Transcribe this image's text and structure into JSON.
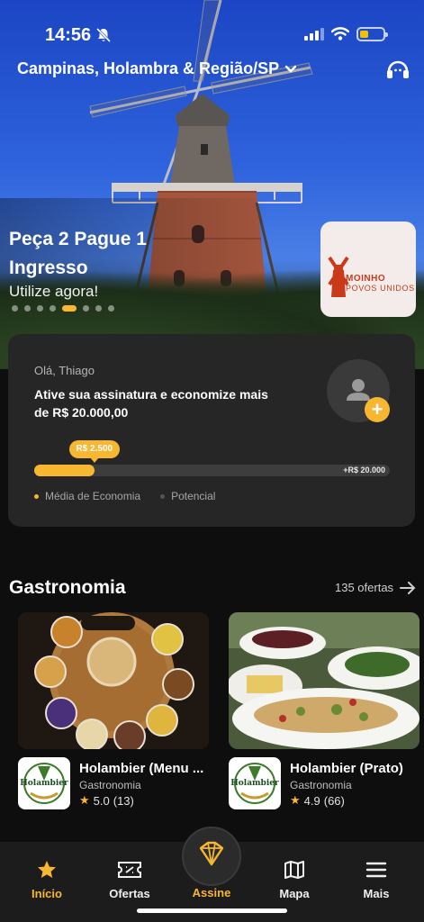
{
  "status_bar": {
    "time": "14:56"
  },
  "header": {
    "location": "Campinas, Holambra & Região/SP"
  },
  "banner": {
    "title": "Peça 2 Pague 1 Ingresso",
    "subtitle": "Utilize agora!",
    "partner_logo_text_1": "MOINHO",
    "partner_logo_text_2": "POVOS UNIDOS",
    "slide_count": 8,
    "active_slide": 5
  },
  "savings_card": {
    "greeting": "Olá, Thiago",
    "pitch": "Ative sua assinatura e economize mais de  R$ 20.000,00",
    "current_label": "R$ 2.500",
    "max_label": "+R$ 20.000",
    "progress_fraction": 0.17,
    "legend": [
      "Média de Economia",
      "Potencial"
    ]
  },
  "section": {
    "title": "Gastronomia",
    "more_label": "135 ofertas",
    "offers": [
      {
        "name": "Holambier (Menu ...",
        "category": "Gastronomia",
        "rating": "5.0",
        "reviews": "(13)",
        "logo_text": "Holambier"
      },
      {
        "name": "Holambier (Prato)",
        "category": "Gastronomia",
        "rating": "4.9",
        "reviews": "(66)",
        "logo_text": "Holambier"
      }
    ]
  },
  "tabbar": {
    "home": "Início",
    "offers": "Ofertas",
    "subscribe": "Assine",
    "map": "Mapa",
    "more": "Mais"
  },
  "colors": {
    "accent": "#f7b731",
    "card": "#262626",
    "background": "#0e0e0e"
  }
}
